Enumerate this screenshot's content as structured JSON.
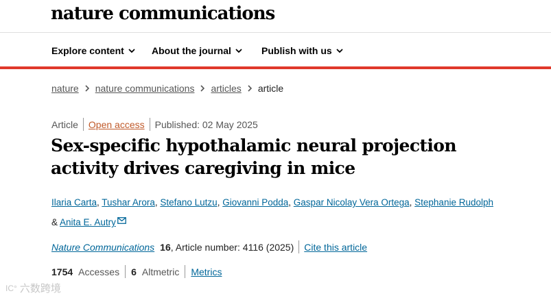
{
  "header": {
    "logo": "nature communications"
  },
  "nav": {
    "items": [
      {
        "label": "Explore content"
      },
      {
        "label": "About the journal"
      },
      {
        "label": "Publish with us"
      }
    ]
  },
  "breadcrumb": {
    "items": [
      "nature",
      "nature communications",
      "articles"
    ],
    "current": "article"
  },
  "article": {
    "type": "Article",
    "access": "Open access",
    "published": "Published: 02 May 2025",
    "title": "Sex-specific hypothalamic neural projection activity drives caregiving in mice",
    "authors": [
      "Ilaria Carta",
      "Tushar Arora",
      "Stefano Lutzu",
      "Giovanni Podda",
      "Gaspar Nicolay Vera Ortega",
      "Stephanie Rudolph"
    ],
    "last_author_prefix": "&",
    "last_author": "Anita E. Autry",
    "journal": "Nature Communications",
    "volume": "16",
    "article_number": ", Article number: 4116 (2025)",
    "cite_label": "Cite this article"
  },
  "metrics": {
    "accesses_value": "1754",
    "accesses_label": "Accesses",
    "altmetric_value": "6",
    "altmetric_label": "Altmetric",
    "metrics_link": "Metrics"
  },
  "watermark": {
    "logo": "IC°",
    "text": "六数跨境"
  },
  "colors": {
    "accent_bar": "#e0392b",
    "link": "#006699",
    "open_access": "#c05a2a"
  },
  "icons": {
    "nav_dropdown": "chevron-down-icon",
    "breadcrumb_sep": "chevron-right-icon",
    "author_contact": "envelope-icon"
  }
}
